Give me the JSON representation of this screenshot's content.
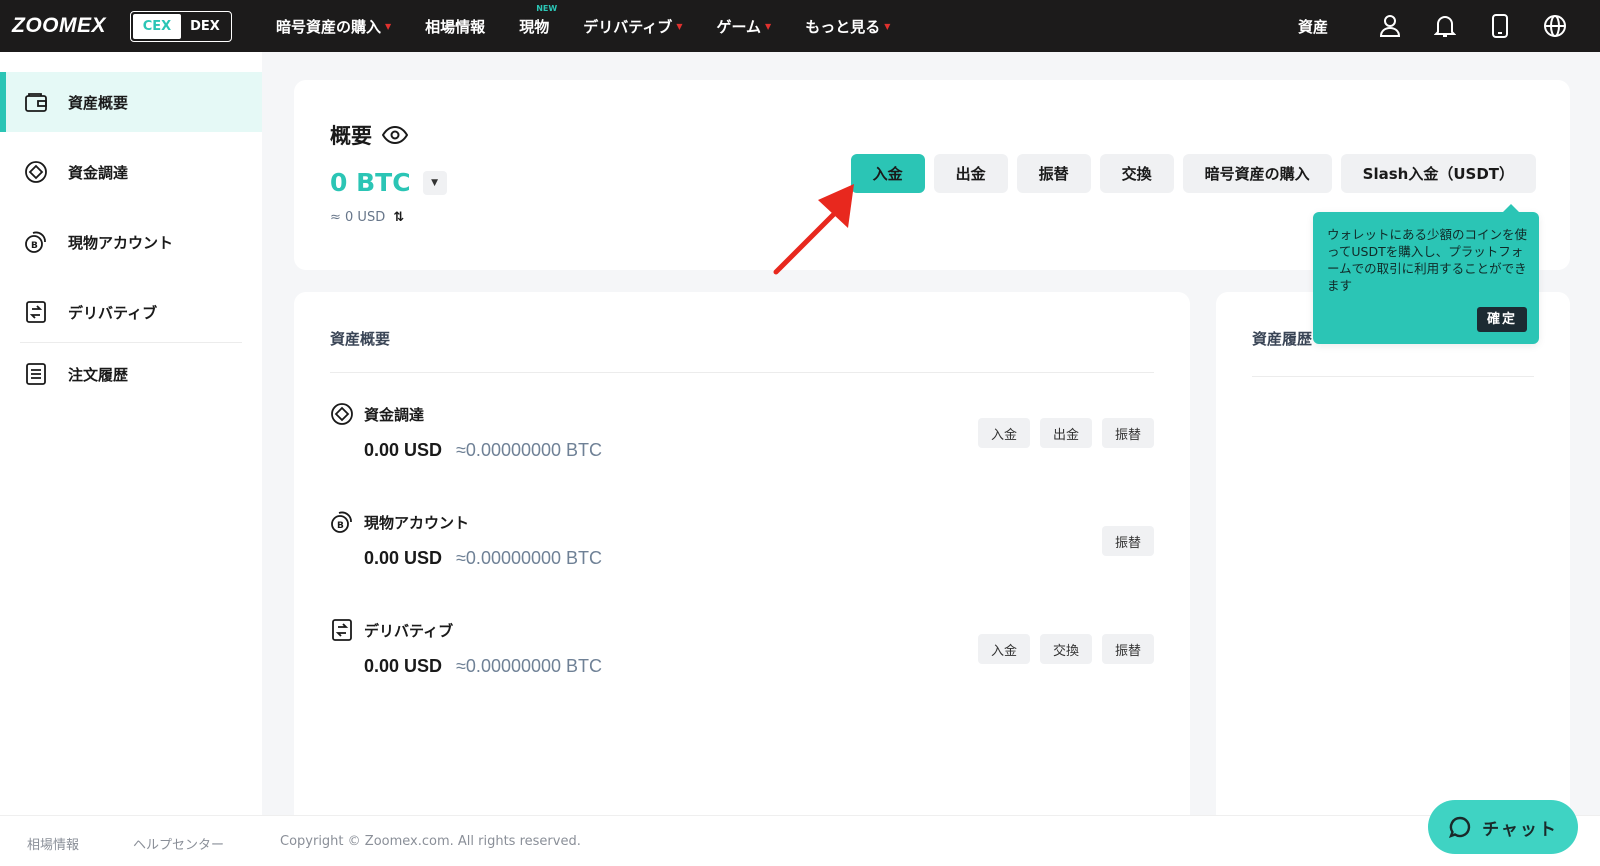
{
  "header": {
    "logo": "ZOOMEX",
    "toggle": {
      "cex": "CEX",
      "dex": "DEX"
    },
    "nav": [
      {
        "label": "暗号資産の購入",
        "has_caret": true
      },
      {
        "label": "相場情報",
        "has_caret": false
      },
      {
        "label": "現物",
        "has_caret": false,
        "badge": "NEW"
      },
      {
        "label": "デリバティブ",
        "has_caret": true
      },
      {
        "label": "ゲーム",
        "has_caret": true
      },
      {
        "label": "もっと見る",
        "has_caret": true
      }
    ],
    "assets_link": "資産",
    "icons": [
      "user-icon",
      "bell-icon",
      "phone-icon",
      "globe-icon"
    ]
  },
  "sidebar": {
    "items": [
      {
        "label": "資産概要",
        "icon": "wallet-icon",
        "active": true
      },
      {
        "label": "資金調達",
        "icon": "diamond-icon",
        "active": false
      },
      {
        "label": "現物アカウント",
        "icon": "coin-icon",
        "active": false
      },
      {
        "label": "デリバティブ",
        "icon": "transfer-doc-icon",
        "active": false
      },
      {
        "label": "注文履歴",
        "icon": "list-doc-icon",
        "active": false
      }
    ]
  },
  "summary": {
    "title": "概要",
    "btc_amount": "0 BTC",
    "usd_estimate": "≈ 0 USD",
    "actions": [
      "入金",
      "出金",
      "振替",
      "交換",
      "暗号資産の購入",
      "Slash入金（USDT）"
    ]
  },
  "overview": {
    "title": "資産概要",
    "accounts": [
      {
        "name": "資金調達",
        "icon": "diamond-icon",
        "usd": "0.00 USD",
        "btc": "≈0.00000000 BTC",
        "buttons": [
          "入金",
          "出金",
          "振替"
        ]
      },
      {
        "name": "現物アカウント",
        "icon": "coin-icon",
        "usd": "0.00 USD",
        "btc": "≈0.00000000 BTC",
        "buttons": [
          "振替"
        ]
      },
      {
        "name": "デリバティブ",
        "icon": "transfer-doc-icon",
        "usd": "0.00 USD",
        "btc": "≈0.00000000 BTC",
        "buttons": [
          "入金",
          "交換",
          "振替"
        ]
      }
    ]
  },
  "history": {
    "title": "資産履歴"
  },
  "tooltip": {
    "text": "ウォレットにある少額のコインを使ってUSDTを購入し、プラットフォームでの取引に利用することができます",
    "confirm": "確定"
  },
  "footer": {
    "links": [
      "相場情報",
      "ヘルプセンター"
    ],
    "copyright": "Copyright © Zoomex.com. All rights reserved."
  },
  "chat": {
    "label": "チャット"
  },
  "colors": {
    "accent": "#2bc5b5",
    "topbar": "#1c1b1b",
    "annotation_arrow": "#e8281e"
  }
}
